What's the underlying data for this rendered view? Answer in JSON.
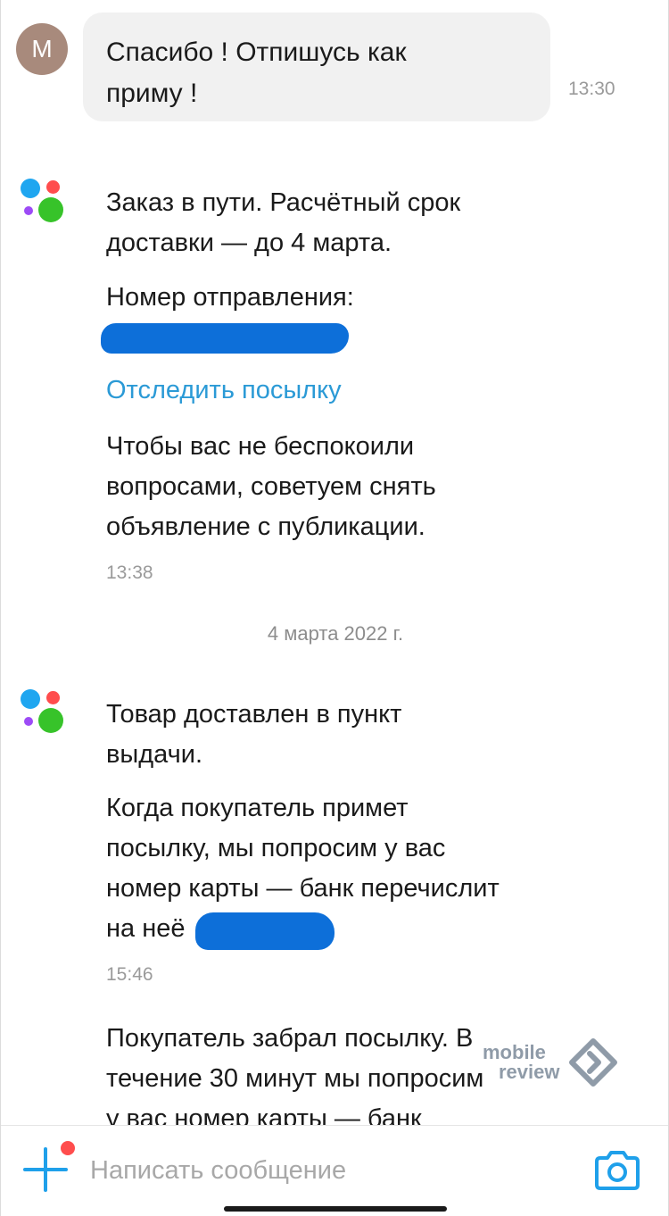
{
  "user_message": {
    "avatar_letter": "М",
    "lines": [
      "Спасибо ! Отпишусь как",
      "приму !"
    ],
    "time": "13:30"
  },
  "bot_message_1": {
    "paragraph_1": [
      "Заказ в пути. Расчётный срок",
      "доставки — до 4 марта."
    ],
    "tracking_label": "Номер отправления:",
    "track_link": "Отследить посылку",
    "paragraph_2": [
      "Чтобы вас не беспокоили",
      "вопросами, советуем снять",
      "объявление с публикации."
    ],
    "time": "13:38"
  },
  "date_separator": "4 марта 2022 г.",
  "bot_message_2": {
    "paragraph_1": [
      "Товар доставлен в пункт",
      "выдачи."
    ],
    "paragraph_2": [
      "Когда покупатель примет",
      "посылку, мы попросим у вас",
      "номер карты — банк перечислит",
      "на неё"
    ],
    "time": "15:46"
  },
  "bot_message_3": {
    "lines": [
      "Покупатель забрал посылку. В",
      "течение 30 минут мы попросим",
      "у вас номер карты — банк"
    ]
  },
  "watermark": [
    "mobile",
    "review"
  ],
  "composer": {
    "placeholder": "Написать сообщение"
  },
  "colors": {
    "accent": "#1fa0ea",
    "link": "#2b9ad6",
    "redaction": "#0d6fd9"
  },
  "icons": {
    "add": "plus-icon",
    "camera": "camera-icon",
    "bot": "avito-logo-icon"
  }
}
